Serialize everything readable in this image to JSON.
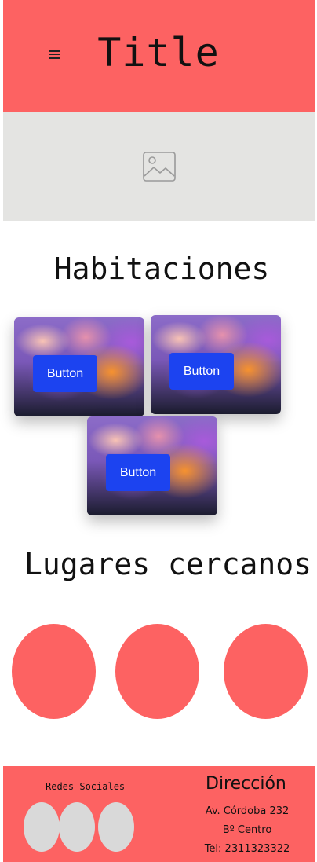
{
  "header": {
    "title": "Title",
    "menu_icon": "hamburger-menu-icon"
  },
  "hero": {
    "icon": "image-placeholder-icon"
  },
  "rooms": {
    "heading": "Habitaciones",
    "cards": [
      {
        "button_label": "Button"
      },
      {
        "button_label": "Button"
      },
      {
        "button_label": "Button"
      }
    ]
  },
  "places": {
    "heading": "Lugares cercanos"
  },
  "footer": {
    "social_heading": "Redes Sociales",
    "address_heading": "Dirección",
    "address_lines": [
      "Av. Córdoba  232",
      "Bº Centro",
      "Tel: 2311323322"
    ]
  },
  "colors": {
    "accent": "#fd6262",
    "button": "#1c43f0",
    "placeholder": "#e4e4e2",
    "social": "#d9d9d9"
  }
}
